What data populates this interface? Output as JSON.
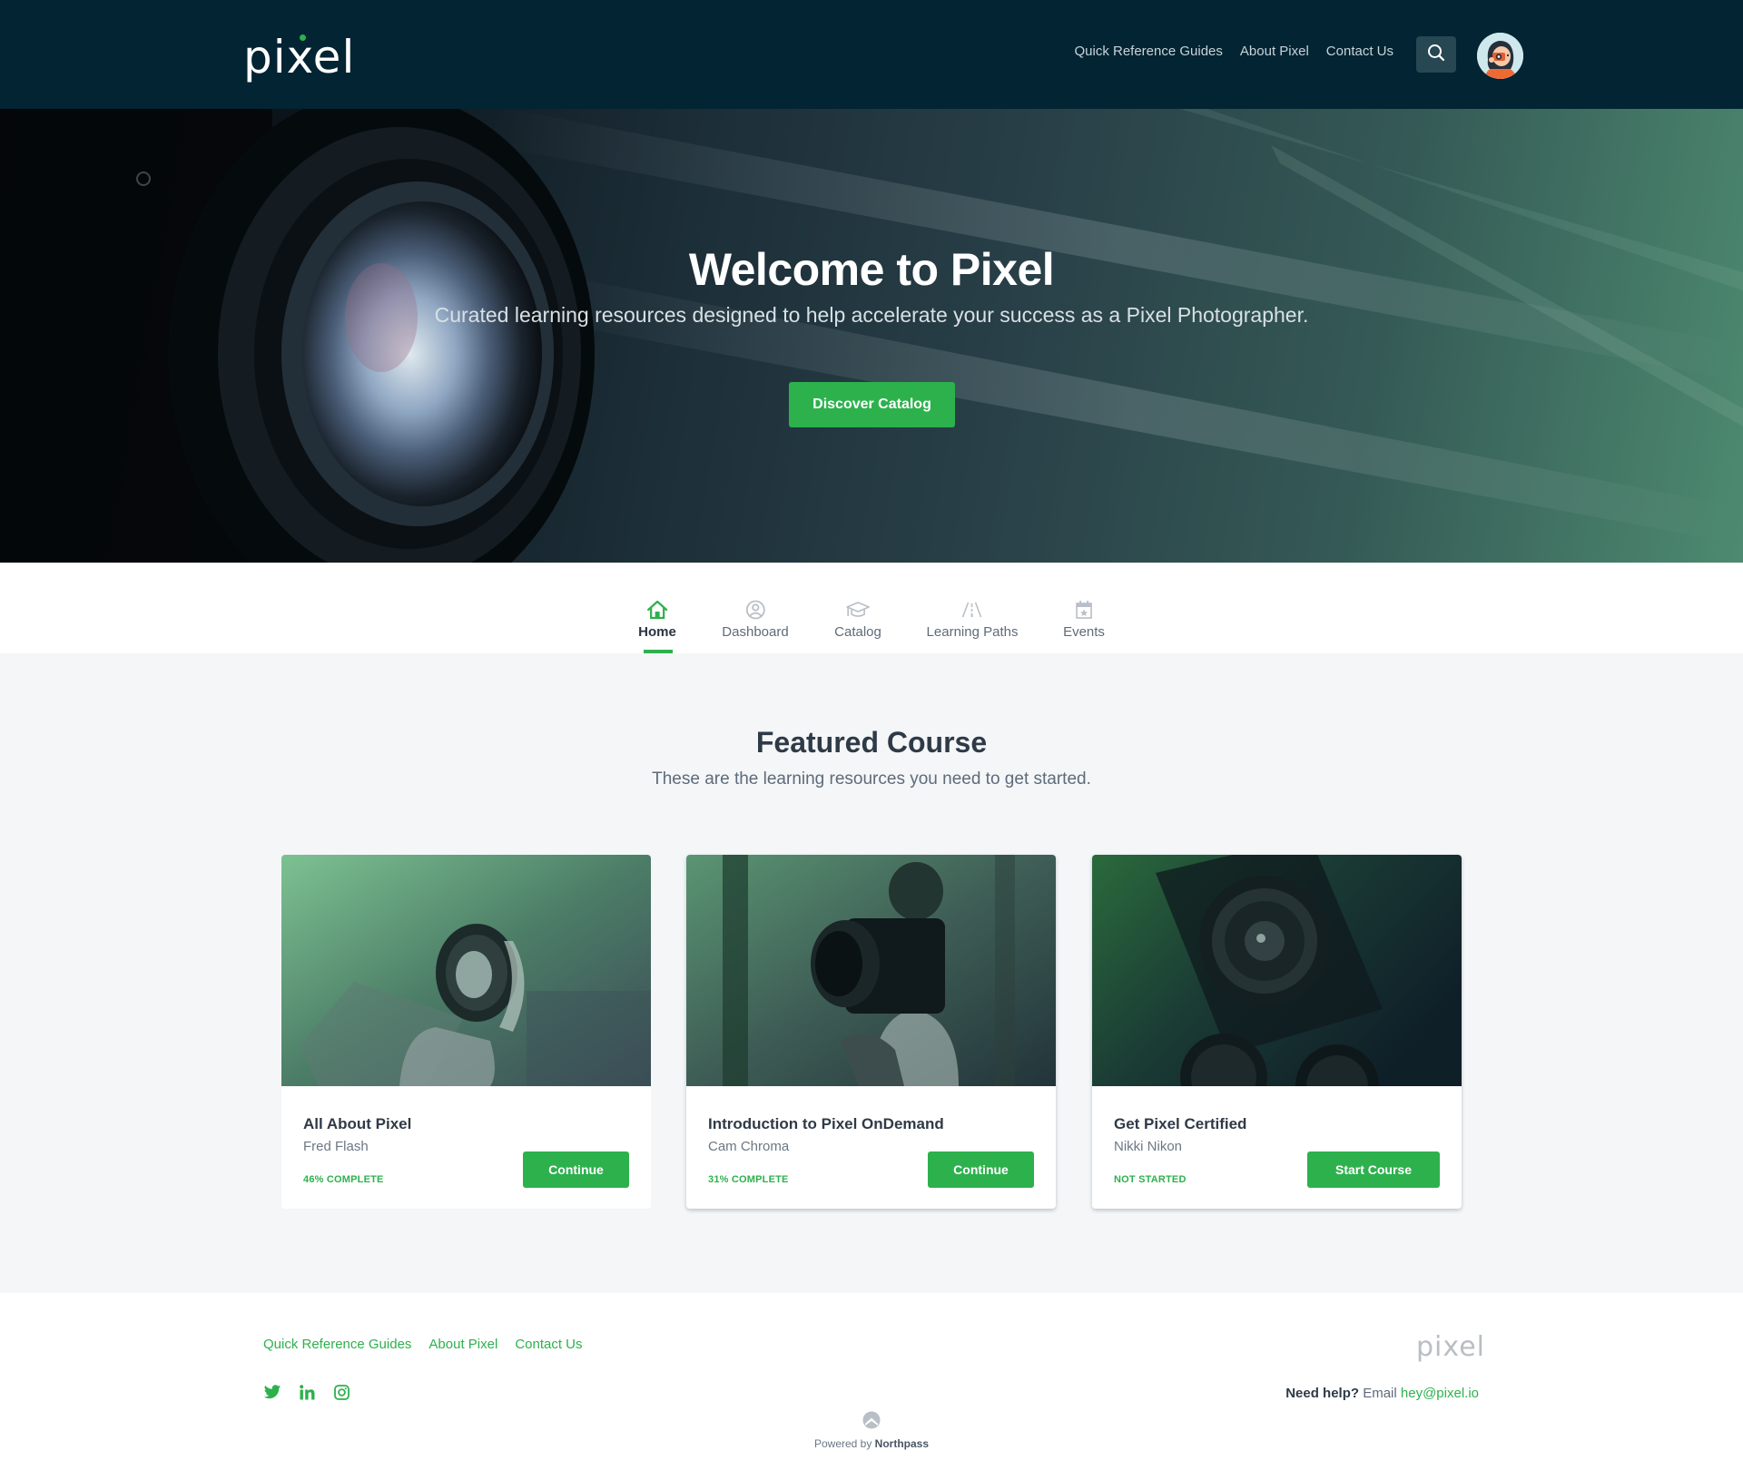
{
  "header": {
    "logo_text": "pixel",
    "nav": [
      "Quick Reference Guides",
      "About Pixel",
      "Contact Us"
    ],
    "search_icon": "search-icon",
    "avatar": "user-avatar-photographer"
  },
  "hero": {
    "title": "Welcome to Pixel",
    "subtitle": "Curated learning resources designed to help accelerate your success as a Pixel Photographer.",
    "cta_label": "Discover Catalog"
  },
  "tabs": [
    {
      "label": "Home",
      "icon": "home-icon",
      "active": true
    },
    {
      "label": "Dashboard",
      "icon": "user-circle-icon",
      "active": false
    },
    {
      "label": "Catalog",
      "icon": "graduation-cap-icon",
      "active": false
    },
    {
      "label": "Learning Paths",
      "icon": "road-icon",
      "active": false
    },
    {
      "label": "Events",
      "icon": "calendar-star-icon",
      "active": false
    }
  ],
  "featured": {
    "title": "Featured Course",
    "subtitle": "These are the learning resources you need to get started.",
    "courses": [
      {
        "title": "All About Pixel",
        "author": "Fred Flash",
        "status": "46% COMPLETE",
        "progress_percent": 46,
        "button": "Continue"
      },
      {
        "title": "Introduction to Pixel OnDemand",
        "author": "Cam Chroma",
        "status": "31% COMPLETE",
        "progress_percent": 31,
        "button": "Continue"
      },
      {
        "title": "Get Pixel Certified",
        "author": "Nikki Nikon",
        "status": "NOT STARTED",
        "progress_percent": 0,
        "button": "Start Course"
      }
    ]
  },
  "footer": {
    "links": [
      "Quick Reference Guides",
      "About Pixel",
      "Contact Us"
    ],
    "social": [
      "twitter-icon",
      "linkedin-icon",
      "instagram-icon"
    ],
    "logo_text": "pixel",
    "help_bold": "Need help?",
    "help_text": " Email ",
    "help_email": "hey@pixel.io",
    "powered_prefix": "Powered by ",
    "powered_brand": "Northpass"
  },
  "colors": {
    "brand_green": "#2db14d",
    "header_bg": "#022433",
    "section_bg": "#f4f6f8",
    "text_dark": "#2f3a47",
    "text_muted": "#5e6b7a"
  }
}
